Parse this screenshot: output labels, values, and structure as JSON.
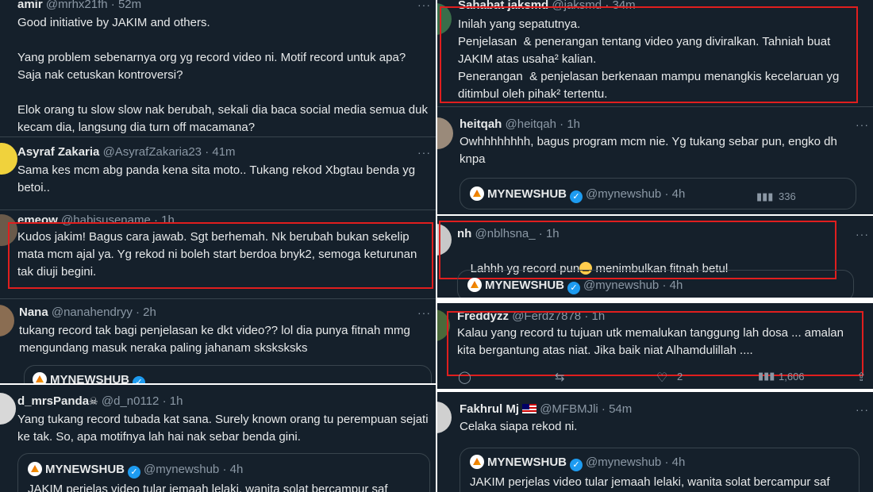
{
  "left": {
    "tweets": [
      {
        "name": "amir",
        "handle": "@mrhx21fh",
        "time": "52m",
        "text": "Good initiative by JAKIM and others.\n\nYang problem sebenarnya org yg record video ni. Motif record untuk apa? Saja nak cetuskan kontroversi?\n\nElok orang tu slow slow nak berubah, sekali dia baca social media semua duk kecam dia, langsung dia turn off macamana?"
      },
      {
        "name": "Asyraf Zakaria",
        "handle": "@AsyrafZakaria23",
        "time": "41m",
        "text": "Sama kes mcm abg panda kena sita moto.. Tukang rekod Xbgtau benda yg betoi.."
      },
      {
        "name": "emeow",
        "handle": "@habisusename",
        "time": "1h",
        "text": "Kudos jakim! Bagus cara jawab. Sgt berhemah. Nk berubah bukan sekelip mata mcm ajal ya. Yg rekod ni boleh start berdoa bnyk2, semoga keturunan tak diuji begini."
      },
      {
        "name": "Nana",
        "handle": "@nanahendryy",
        "time": "2h",
        "text": "tukang record tak bagi penjelasan ke dkt video?? lol dia punya fitnah mmg mengundang masuk neraka paling jahanam sksksksks",
        "quote_name": "MYNEWSHUB"
      }
    ],
    "bottom": {
      "name": "d_mrsPanda",
      "name_emoji": "☠",
      "handle": "@d_n0112",
      "time": "1h",
      "text": "Yang tukang record tubada kat sana. Surely known orang tu perempuan sejati ke tak. So, apa motifnya lah hai nak sebar benda gini.",
      "quote_name": "MYNEWSHUB",
      "quote_handle": "@mynewshub",
      "quote_time": "4h",
      "quote_text": "JAKIM perjelas video tular jemaah lelaki, wanita solat bercampur saf"
    }
  },
  "right": {
    "top": {
      "name": "Sahabat jaksmd",
      "handle": "@jaksmd",
      "time": "34m",
      "text": "Inilah yang sepatutnya.\nPenjelasan  & penerangan tentang video yang diviralkan. Tahniah buat JAKIM atas usaha² kalian.\nPenerangan  & penjelasan berkenaan mampu menangkis kecelaruan yg ditimbul oleh pihak² tertentu."
    },
    "heitqah": {
      "name": "heitqah",
      "handle": "@heitqah",
      "time": "1h",
      "text": "Owhhhhhhhh, bagus program mcm nie. Yg tukang sebar pun, engko dh knpa",
      "quote_name": "MYNEWSHUB",
      "quote_handle": "@mynewshub",
      "quote_time": "4h",
      "views": "336"
    },
    "nh": {
      "name": "nh",
      "handle": "@nblhsna_",
      "time": "1h",
      "text": "Lahhh yg record pun",
      "text2": " menimbulkan fitnah betul",
      "quote_name": "MYNEWSHUB",
      "quote_handle": "@mynewshub",
      "quote_time": "4h"
    },
    "freddyzz": {
      "name": "Freddyzz",
      "handle": "@Ferdz7878",
      "time": "1h",
      "text": "Kalau yang record tu tujuan utk memalukan tanggung lah dosa ... amalan kita bergantung atas niat. Jika baik niat Alhamdulillah ....",
      "likes": "2",
      "views": "1,606"
    },
    "fakhrul": {
      "name": "Fakhrul Mj",
      "handle": "@MFBMJli",
      "time": "54m",
      "text": "Celaka siapa rekod ni.",
      "quote_name": "MYNEWSHUB",
      "quote_handle": "@mynewshub",
      "quote_time": "4h",
      "quote_text": "JAKIM perjelas video tular jemaah lelaki, wanita solat bercampur saf"
    }
  },
  "more_glyph": "···",
  "sep": "·",
  "verified_glyph": "✓",
  "colors": {
    "bg": "#15202b",
    "border": "#38444d",
    "muted": "#8b98a5",
    "highlight": "#e01e1e",
    "verified": "#1d9bf0"
  }
}
